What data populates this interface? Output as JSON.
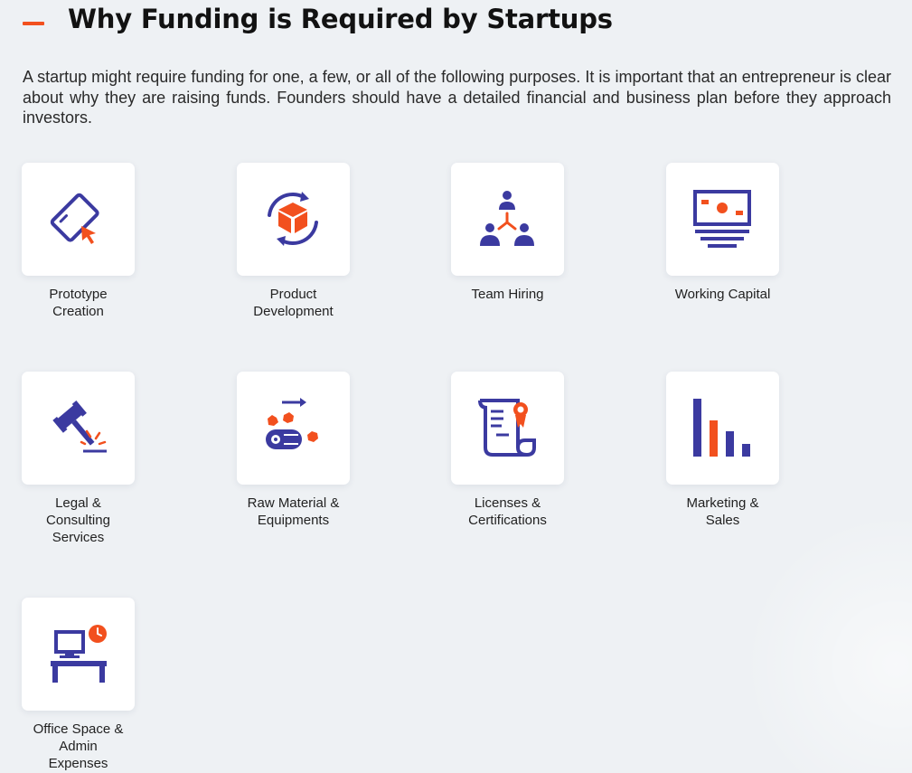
{
  "header": {
    "title": "Why Funding is Required by Startups"
  },
  "intro": "A startup might require funding for one, a few, or all of the following purposes. It is important that an entrepreneur is clear about why they are raising funds. Founders should have a detailed financial and business plan before they approach investors.",
  "colors": {
    "accent": "#f2501e",
    "primary": "#3b3aa0",
    "background": "#eef1f4"
  },
  "cards": [
    {
      "icon": "prototype-cursor-icon",
      "lines": [
        "Prototype",
        "Creation"
      ]
    },
    {
      "icon": "product-cube-cycle-icon",
      "lines": [
        "Product",
        "Development"
      ]
    },
    {
      "icon": "team-hierarchy-icon",
      "lines": [
        "Team Hiring"
      ]
    },
    {
      "icon": "monitor-cash-icon",
      "lines": [
        "Working Capital"
      ]
    },
    {
      "icon": "gavel-icon",
      "lines": [
        "Legal &",
        "Consulting",
        "Services"
      ]
    },
    {
      "icon": "conveyor-materials-icon",
      "lines": [
        "Raw Material &",
        "Equipments"
      ]
    },
    {
      "icon": "certificate-scroll-icon",
      "lines": [
        "Licenses &",
        "Certifications"
      ]
    },
    {
      "icon": "bar-chart-icon",
      "lines": [
        "Marketing &",
        "Sales"
      ]
    },
    {
      "icon": "office-desk-icon",
      "lines": [
        "Office Space &",
        "Admin",
        "Expenses"
      ]
    }
  ]
}
